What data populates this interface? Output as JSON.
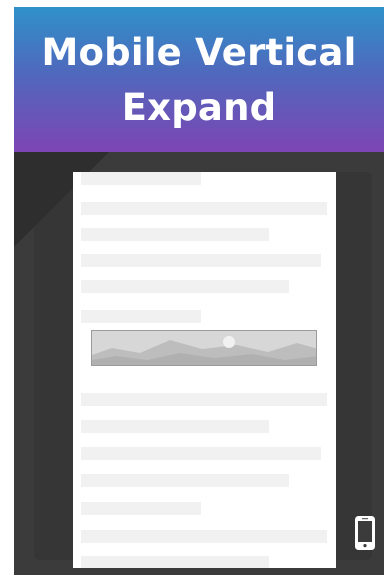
{
  "header": {
    "title": "Mobile Vertical Expand"
  },
  "preview": {
    "image_icon": "landscape-image-icon"
  },
  "device": {
    "icon": "mobile-phone-icon"
  },
  "colors": {
    "header_top": "#2f91c9",
    "header_bottom": "#7d45b3",
    "background": "#3b3b3b",
    "paper": "#ffffff",
    "placeholder": "#f1f1f1"
  }
}
